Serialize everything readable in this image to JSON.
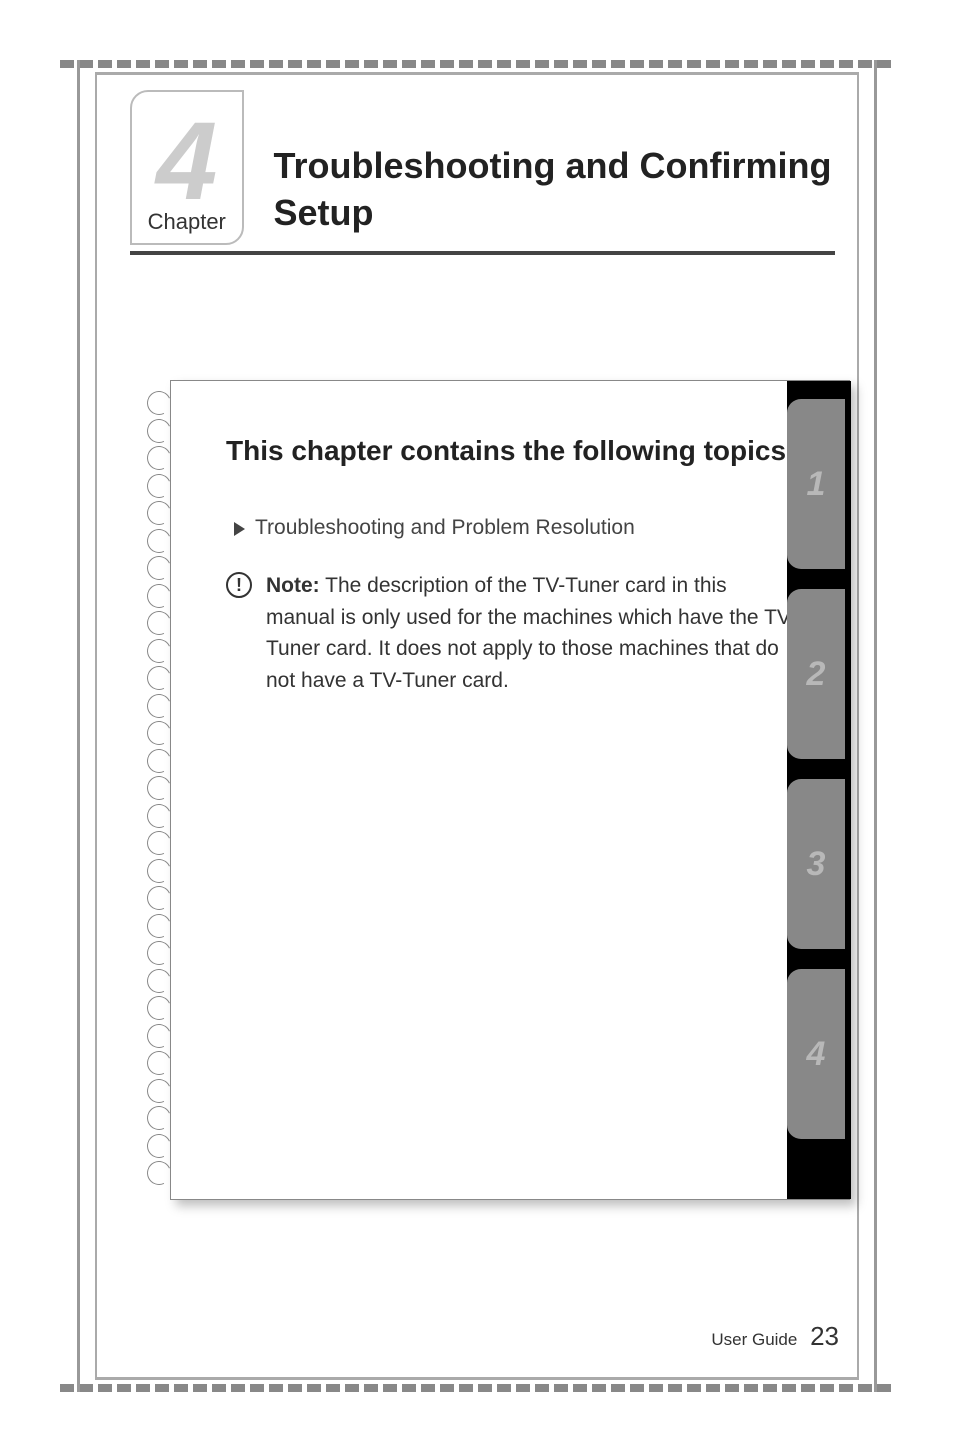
{
  "chapter": {
    "number": "4",
    "label": "Chapter",
    "title": "Troubleshooting and Confirming Setup"
  },
  "topics_card": {
    "heading": "This chapter contains the following topics:",
    "items": [
      "Troubleshooting and Problem Resolution"
    ],
    "note": {
      "label": "Note:",
      "text": " The description of the TV-Tuner card in this manual is only used for the machines which have the TV-Tuner card. It does not apply to those machines that do not have a TV-Tuner card."
    }
  },
  "tabs": [
    "1",
    "2",
    "3",
    "4"
  ],
  "footer": {
    "label": "User Guide",
    "page": "23"
  }
}
